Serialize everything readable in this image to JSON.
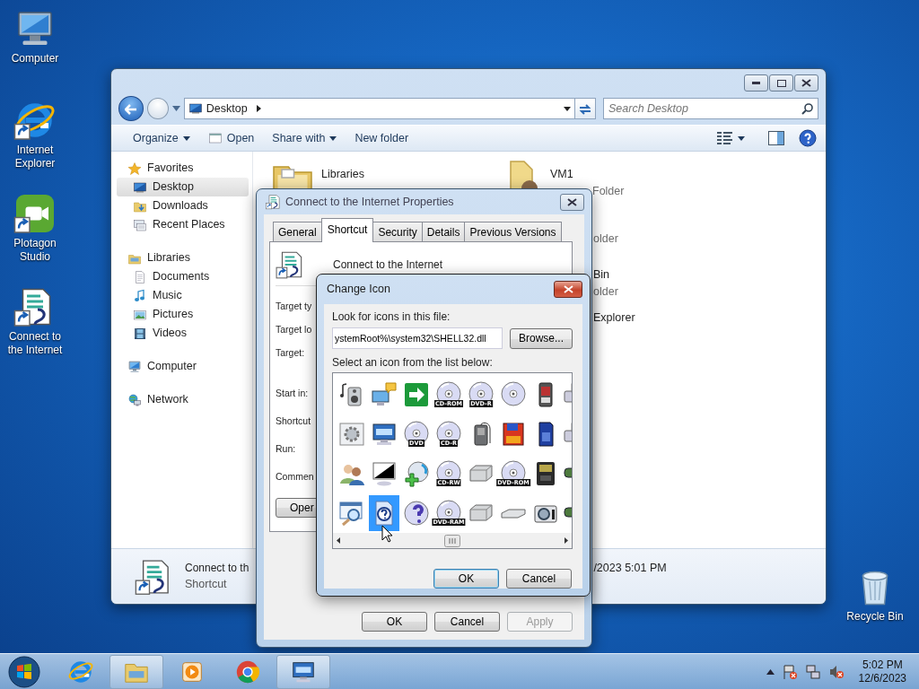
{
  "desktop_icons": [
    {
      "label": "Computer",
      "kind": "computer"
    },
    {
      "label": "Internet Explorer",
      "kind": "ie"
    },
    {
      "label": "Plotagon Studio",
      "kind": "plotagon"
    },
    {
      "label": "Connect to the Internet",
      "kind": "script"
    },
    {
      "label": "Recycle Bin",
      "kind": "bin"
    }
  ],
  "explorer": {
    "address": "Desktop",
    "search": {
      "placeholder": "Search Desktop"
    },
    "toolbar": [
      {
        "label": "Organize",
        "kind": "menu"
      },
      {
        "label": "Open",
        "kind": "open"
      },
      {
        "label": "Share with",
        "kind": "menu"
      },
      {
        "label": "New folder",
        "kind": "plain"
      }
    ],
    "sidebar": [
      {
        "label": "Favorites",
        "kind": "star",
        "selected": false,
        "children": [
          {
            "label": "Desktop",
            "kind": "desktop",
            "selected": true
          },
          {
            "label": "Downloads",
            "kind": "downloads",
            "selected": false
          },
          {
            "label": "Recent Places",
            "kind": "recent",
            "selected": false
          }
        ]
      },
      {
        "label": "Libraries",
        "kind": "library",
        "selected": false,
        "children": [
          {
            "label": "Documents",
            "kind": "documents",
            "selected": false
          },
          {
            "label": "Music",
            "kind": "music",
            "selected": false
          },
          {
            "label": "Pictures",
            "kind": "pictures",
            "selected": false
          },
          {
            "label": "Videos",
            "kind": "videos",
            "selected": false
          }
        ]
      },
      {
        "label": "Computer",
        "kind": "computer",
        "selected": false
      },
      {
        "label": "Network",
        "kind": "network",
        "selected": false
      }
    ],
    "items": [
      {
        "name": "Libraries",
        "kind": "libfolder"
      },
      {
        "name": "VM1",
        "sub": "Folder",
        "kind": "userfolder"
      },
      {
        "sub": "older",
        "kind": "hidden"
      },
      {
        "name": "Bin",
        "sub": "older",
        "kind": "hidden"
      },
      {
        "name": "Explorer",
        "kind": "hidden"
      }
    ],
    "details": {
      "name": "Connect to th",
      "type": "Shortcut",
      "date": "/2023 5:01 PM"
    }
  },
  "properties": {
    "title": "Connect to the Internet Properties",
    "tabs": [
      {
        "label": "General",
        "selected": false
      },
      {
        "label": "Shortcut",
        "selected": true
      },
      {
        "label": "Security",
        "selected": false
      },
      {
        "label": "Details",
        "selected": false
      },
      {
        "label": "Previous Versions",
        "selected": false
      }
    ],
    "name": "Connect to the Internet",
    "fields": [
      "Target ty",
      "Target lo",
      "Target:",
      "Start in:",
      "Shortcut",
      "Run:",
      "Commen"
    ],
    "open_button": "Oper",
    "buttons": [
      {
        "label": "OK",
        "disabled": false
      },
      {
        "label": "Cancel",
        "disabled": false
      },
      {
        "label": "Apply",
        "disabled": true
      }
    ]
  },
  "change_icon": {
    "title": "Change Icon",
    "file_label": "Look for icons in this file:",
    "file_value": "ystemRoot%\\system32\\SHELL32.dll",
    "browse": "Browse...",
    "list_label": "Select an icon from the list below:",
    "icons": [
      {
        "kind": "speaker",
        "selected": false
      },
      {
        "kind": "chat",
        "selected": false
      },
      {
        "kind": "arrow",
        "selected": false
      },
      {
        "kind": "disc",
        "label": "CD-ROM",
        "selected": false
      },
      {
        "kind": "disc",
        "label": "DVD-R",
        "selected": false
      },
      {
        "kind": "disc",
        "selected": false
      },
      {
        "kind": "memory",
        "selected": false
      },
      {
        "kind": "printer",
        "selected": false
      },
      {
        "kind": "gear",
        "selected": false
      },
      {
        "kind": "keyboard",
        "selected": false
      },
      {
        "kind": "disc",
        "label": "DVD",
        "selected": false
      },
      {
        "kind": "disc",
        "label": "CD-R",
        "selected": false
      },
      {
        "kind": "player",
        "selected": false
      },
      {
        "kind": "floppy",
        "selected": false
      },
      {
        "kind": "sdcard",
        "selected": false
      },
      {
        "kind": "printer",
        "selected": false
      },
      {
        "kind": "people",
        "selected": false
      },
      {
        "kind": "monitor",
        "selected": false
      },
      {
        "kind": "discplus",
        "selected": false
      },
      {
        "kind": "disc",
        "label": "CD-RW",
        "selected": false
      },
      {
        "kind": "drive",
        "selected": false
      },
      {
        "kind": "disc",
        "label": "DVD-ROM",
        "selected": false
      },
      {
        "kind": "chip",
        "selected": false
      },
      {
        "kind": "stick",
        "selected": false
      },
      {
        "kind": "search",
        "selected": false
      },
      {
        "kind": "help",
        "selected": true
      },
      {
        "kind": "discq",
        "selected": false
      },
      {
        "kind": "disc",
        "label": "DVD-RAM",
        "selected": false
      },
      {
        "kind": "drive",
        "selected": false
      },
      {
        "kind": "flatdrive",
        "selected": false
      },
      {
        "kind": "camera",
        "selected": false
      },
      {
        "kind": "stick",
        "selected": false
      }
    ],
    "buttons": [
      "OK",
      "Cancel"
    ]
  },
  "taskbar": {
    "apps": [
      {
        "kind": "ie",
        "active": false
      },
      {
        "kind": "explorer",
        "active": true
      },
      {
        "kind": "media",
        "active": false
      },
      {
        "kind": "chrome",
        "active": false
      },
      {
        "kind": "keyboard",
        "active": true
      }
    ],
    "time": "5:02 PM",
    "date": "12/6/2023"
  }
}
